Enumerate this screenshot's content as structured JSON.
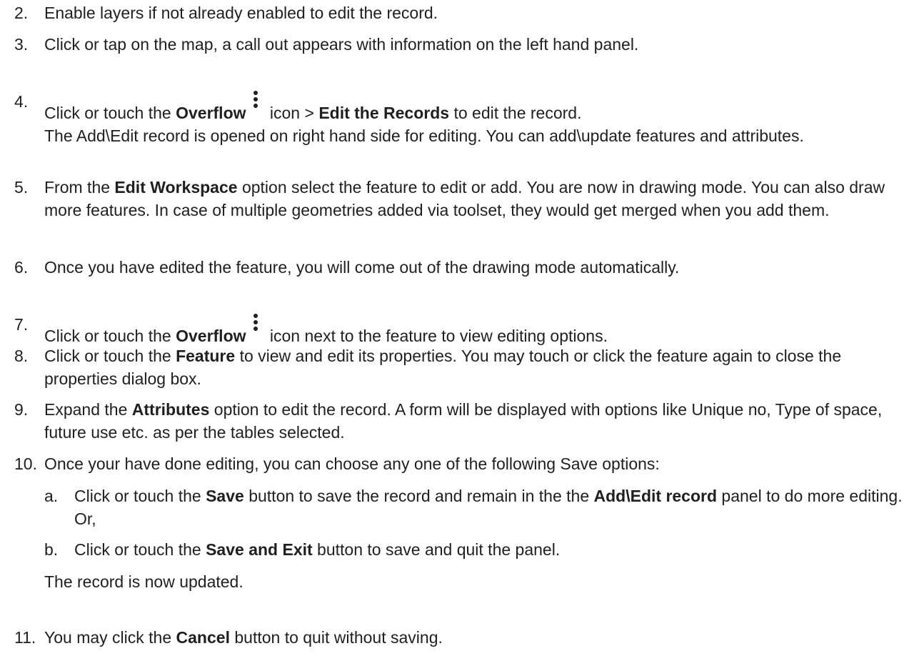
{
  "steps": [
    {
      "num": "2.",
      "text": "Enable layers if not already enabled to edit the record."
    },
    {
      "num": "3.",
      "text": "Click or tap on the map, a call out appears with information on the left hand panel."
    },
    {
      "num": "4.",
      "pre": "Click or touch the ",
      "b1": "Overflow",
      "mid": " icon > ",
      "b2": "Edit the Records",
      "post": " to edit the record.",
      "line2": "The Add\\Edit record is opened on right hand side for editing. You can add\\update features and attributes."
    },
    {
      "num": "5.",
      "pre": "From the ",
      "b1": "Edit Workspace",
      "post": " option select the feature to edit or add. You are now in drawing mode. You can also draw more features. In case of multiple geometries added via toolset, they would get merged when you add them."
    },
    {
      "num": "6.",
      "text": "Once you have edited the feature, you will come out of the drawing mode automatically."
    },
    {
      "num": "7.",
      "pre": "Click or touch the ",
      "b1": "Overflow",
      "post": " icon next to the feature to view editing options."
    },
    {
      "num": "8.",
      "pre": "Click or touch the ",
      "b1": "Feature",
      "post": " to view and edit its properties. You may touch or click the feature again to close the properties dialog box."
    },
    {
      "num": "9.",
      "pre": "Expand the ",
      "b1": "Attributes",
      "post": " option to edit the record. A form will be displayed with options like Unique no, Type of space, future use etc. as per the tables selected."
    },
    {
      "num": "10.",
      "text": "Once your have done editing, you can choose any one of the following Save options:"
    },
    {
      "num": "11.",
      "pre": "You may click the ",
      "b1": "Cancel",
      "post": " button to quit without saving."
    }
  ],
  "substeps": [
    {
      "num": "a.",
      "pre": "Click or touch the ",
      "b1": "Save",
      "mid": " button to save the record and remain in the the ",
      "b2": "Add\\Edit record",
      "post": " panel to do more editing. Or,"
    },
    {
      "num": "b.",
      "pre": "Click or touch the ",
      "b1": "Save and Exit",
      "post": " button to save and quit the panel."
    }
  ],
  "result": "The record is now updated.",
  "icons": {
    "overflow": "overflow-vertical-dots-icon"
  }
}
